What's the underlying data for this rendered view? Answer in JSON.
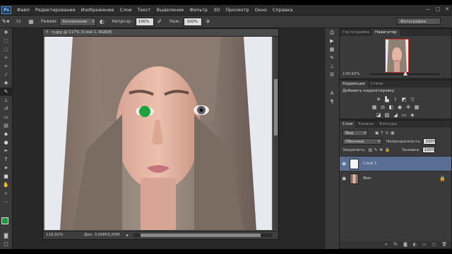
{
  "app": {
    "logo": "Ps"
  },
  "menu": [
    "Файл",
    "Редактирование",
    "Изображение",
    "Слои",
    "Текст",
    "Выделение",
    "Фильтр",
    "3D",
    "Просмотр",
    "Окно",
    "Справка"
  ],
  "window_controls": [
    "—",
    "□",
    "✕"
  ],
  "options_bar": {
    "brush_size": "13",
    "mode_label": "Режим:",
    "mode_value": "Затемнение",
    "opacity_label": "Непрозр.:",
    "opacity_value": "100%",
    "flow_label": "Наж.:",
    "flow_value": "100%",
    "workspace": "Фотография"
  },
  "document": {
    "tab_title": "ry.jpg @ 117% (Слой 1, RGB/8)",
    "zoom": "116,92%",
    "doc_info": "Док: 3,00M/3,00M",
    "foreground_color": "#1a9c3a",
    "background_color": "#ffffff"
  },
  "navigator": {
    "tabs": [
      "Гистограмма",
      "Навигатор"
    ],
    "active_tab": "Навигатор",
    "zoom": "116,92%"
  },
  "adjustments": {
    "tabs": [
      "Коррекция",
      "Стили"
    ],
    "active_tab": "Коррекция",
    "title": "Добавить корректировку"
  },
  "layers": {
    "tabs": [
      "Слои",
      "Каналы",
      "Контуры"
    ],
    "active_tab": "Слои",
    "filter": "Вид",
    "blend_mode": "Обычные",
    "opacity_label": "Непрозрачность:",
    "opacity_value": "100%",
    "lock_label": "Закрепить:",
    "fill_label": "Заливка:",
    "fill_value": "100%",
    "items": [
      {
        "name": "Слой 1",
        "selected": true
      },
      {
        "name": "Фон",
        "selected": false,
        "locked": true
      }
    ]
  },
  "icons": {
    "tools": [
      "move-icon",
      "marquee-icon",
      "lasso-icon",
      "quick-select-icon",
      "crop-icon",
      "eyedropper-icon",
      "healing-icon",
      "brush-icon",
      "clone-stamp-icon",
      "history-brush-icon",
      "eraser-icon",
      "gradient-icon",
      "blur-icon",
      "dodge-icon",
      "pen-icon",
      "type-icon",
      "path-select-icon",
      "shape-icon",
      "hand-icon",
      "zoom-icon"
    ]
  }
}
